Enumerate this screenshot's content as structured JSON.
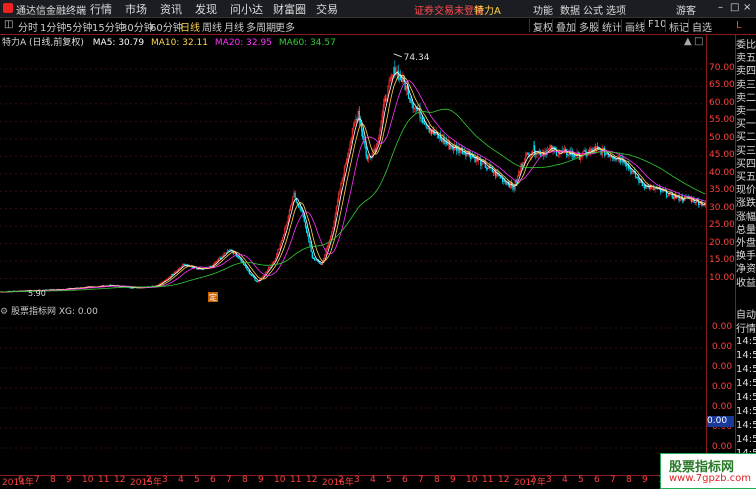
{
  "app": {
    "name": "通达信金融终端"
  },
  "menu": [
    "行情",
    "市场",
    "资讯",
    "发现",
    "问小达",
    "财富圈",
    "交易"
  ],
  "status": {
    "warning": "证券交易未登录",
    "security": "特力A"
  },
  "right_menu": [
    "功能",
    "数据",
    "公式",
    "选项",
    "游客"
  ],
  "toolbar": {
    "periods": [
      "分时",
      "1分钟",
      "5分钟",
      "15分钟",
      "30分钟",
      "60分钟",
      "日线",
      "周线",
      "月线",
      "多周期",
      "更多"
    ],
    "active": "日线",
    "buttons": [
      "复权",
      "叠加",
      "多股",
      "统计",
      "画线",
      "F10",
      "标记",
      "自选"
    ]
  },
  "info": {
    "title": "特力A (日线,前复权)",
    "ma5": "MA5: 30.79",
    "ma10": "MA10: 32.11",
    "ma20": "MA20: 32.95",
    "ma60": "MA60: 34.57",
    "peak_label": "74.34",
    "low_label": "5.90",
    "marker": "定"
  },
  "sub": {
    "title": "股票指标网 XG: 0.00"
  },
  "colors": {
    "up": "#ff3030",
    "down": "#00e5ff",
    "ma5": "#ffffff",
    "ma10": "#ffd24d",
    "ma20": "#ff33ff",
    "ma60": "#33cc33"
  },
  "right_panel": {
    "labels": [
      "委比",
      "卖五",
      "卖四",
      "卖三",
      "卖二",
      "卖一",
      "买一",
      "买二",
      "买三",
      "买四",
      "买五",
      "现价",
      "涨跌",
      "涨幅",
      "总量",
      "外盘",
      "换手",
      "净资",
      "收益"
    ],
    "labels2": [
      "自动",
      "行情"
    ],
    "times": [
      "14:55",
      "14:56",
      "14:56",
      "14:56",
      "14:56",
      "14:56",
      "14:56",
      "14:56",
      "14:56"
    ],
    "top_label": "L"
  },
  "watermark": {
    "name": "股票指标网",
    "url": "www.7gpzb.com"
  },
  "chart_data": {
    "type": "candlestick",
    "price_axis": {
      "ticks": [
        70.0,
        65.0,
        60.0,
        55.0,
        50.0,
        45.0,
        40.0,
        35.0,
        30.0,
        25.0,
        20.0,
        15.0,
        10.0
      ],
      "range": [
        3,
        76
      ]
    },
    "sub_axis": {
      "ticks": [
        "0.00",
        "0.00",
        "0.00",
        "0.00",
        "0.00",
        "0.00",
        "0.00"
      ],
      "current": "0.00"
    },
    "x_labels": [
      "2014年",
      "6",
      "7",
      "8",
      "9",
      "10",
      "11",
      "12",
      "2015年",
      "2",
      "3",
      "4",
      "5",
      "6",
      "7",
      "8",
      "9",
      "10",
      "11",
      "12",
      "2016年",
      "2",
      "3",
      "4",
      "5",
      "6",
      "7",
      "8",
      "9",
      "10",
      "11",
      "12",
      "2017年",
      "2",
      "3",
      "4",
      "5",
      "6",
      "7",
      "8",
      "9",
      "10",
      "11"
    ],
    "closes": [
      6.2,
      6.3,
      6.4,
      6.5,
      6.6,
      6.7,
      6.8,
      7.0,
      7.2,
      7.4,
      7.6,
      7.8,
      8.0,
      7.8,
      7.5,
      7.4,
      7.6,
      8.0,
      9.5,
      12.0,
      14.0,
      13.0,
      12.5,
      13.5,
      16.0,
      18.5,
      16.0,
      12.0,
      9.0,
      12.0,
      16.0,
      24.0,
      34.0,
      28.0,
      16.0,
      14.0,
      22.0,
      35.0,
      48.0,
      58.0,
      44.0,
      48.0,
      62.0,
      70.0,
      66.0,
      60.0,
      56.0,
      52.0,
      50.0,
      48.0,
      47.0,
      46.0,
      44.0,
      42.0,
      40.0,
      38.0,
      36.0,
      44.0,
      47.0,
      46.0,
      47.0,
      46.0,
      46.0,
      45.0,
      46.0,
      47.0,
      46.0,
      45.0,
      44.0,
      40.0,
      37.0,
      36.0,
      35.0,
      34.0,
      33.0,
      33.0,
      32.0,
      31.0
    ]
  }
}
